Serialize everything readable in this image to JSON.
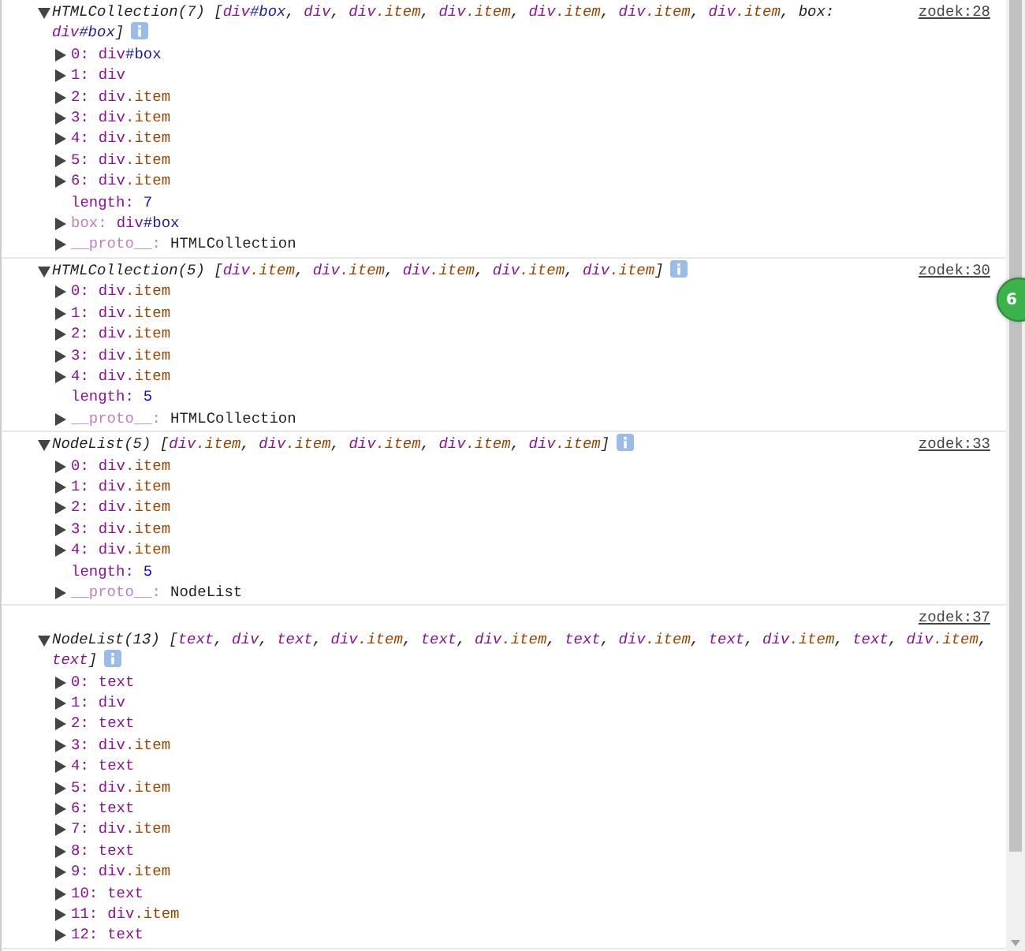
{
  "entries": [
    {
      "source": "zodek:28",
      "source_above": false,
      "expanded": true,
      "type": "HTMLCollection(7)",
      "open": "[",
      "close": "]",
      "preview": [
        {
          "tag": "div",
          "id": "#box",
          "sep": ", "
        },
        {
          "tag": "div",
          "sep": ", "
        },
        {
          "tag": "div",
          "cls": ".item",
          "sep": ", "
        },
        {
          "tag": "div",
          "cls": ".item",
          "sep": ", "
        },
        {
          "tag": "div",
          "cls": ".item",
          "sep": ", "
        },
        {
          "tag": "div",
          "cls": ".item",
          "sep": ", "
        },
        {
          "tag": "div",
          "cls": ".item",
          "sep": ", "
        },
        {
          "key": "box: ",
          "tag": "div",
          "id": "#box"
        }
      ],
      "items": [
        {
          "key": "0:",
          "dimmed": false,
          "expanded": false,
          "value": {
            "tag": "div",
            "id": "#box"
          }
        },
        {
          "key": "1:",
          "dimmed": false,
          "expanded": false,
          "value": {
            "tag": "div"
          }
        },
        {
          "key": "2:",
          "dimmed": false,
          "expanded": false,
          "value": {
            "tag": "div",
            "cls": ".item"
          }
        },
        {
          "key": "3:",
          "dimmed": false,
          "expanded": false,
          "value": {
            "tag": "div",
            "cls": ".item"
          }
        },
        {
          "key": "4:",
          "dimmed": false,
          "expanded": false,
          "value": {
            "tag": "div",
            "cls": ".item"
          }
        },
        {
          "key": "5:",
          "dimmed": false,
          "expanded": false,
          "value": {
            "tag": "div",
            "cls": ".item"
          }
        },
        {
          "key": "6:",
          "dimmed": false,
          "expanded": false,
          "value": {
            "tag": "div",
            "cls": ".item"
          }
        },
        {
          "key": "length:",
          "dimmed": false,
          "value": {
            "num": "7"
          }
        },
        {
          "key": "box:",
          "dimmed": true,
          "expanded": false,
          "value": {
            "tag": "div",
            "id": "#box"
          }
        },
        {
          "key": "__proto__:",
          "dimmed": true,
          "expanded": false,
          "value": {
            "text": "HTMLCollection"
          }
        }
      ]
    },
    {
      "source": "zodek:30",
      "source_above": false,
      "expanded": true,
      "type": "HTMLCollection(5)",
      "open": "[",
      "close": "]",
      "preview": [
        {
          "tag": "div",
          "cls": ".item",
          "sep": ", "
        },
        {
          "tag": "div",
          "cls": ".item",
          "sep": ", "
        },
        {
          "tag": "div",
          "cls": ".item",
          "sep": ", "
        },
        {
          "tag": "div",
          "cls": ".item",
          "sep": ", "
        },
        {
          "tag": "div",
          "cls": ".item"
        }
      ],
      "items": [
        {
          "key": "0:",
          "dimmed": false,
          "expanded": false,
          "value": {
            "tag": "div",
            "cls": ".item"
          }
        },
        {
          "key": "1:",
          "dimmed": false,
          "expanded": false,
          "value": {
            "tag": "div",
            "cls": ".item"
          }
        },
        {
          "key": "2:",
          "dimmed": false,
          "expanded": false,
          "value": {
            "tag": "div",
            "cls": ".item"
          }
        },
        {
          "key": "3:",
          "dimmed": false,
          "expanded": false,
          "value": {
            "tag": "div",
            "cls": ".item"
          }
        },
        {
          "key": "4:",
          "dimmed": false,
          "expanded": false,
          "value": {
            "tag": "div",
            "cls": ".item"
          }
        },
        {
          "key": "length:",
          "dimmed": false,
          "value": {
            "num": "5"
          }
        },
        {
          "key": "__proto__:",
          "dimmed": true,
          "expanded": false,
          "value": {
            "text": "HTMLCollection"
          }
        }
      ]
    },
    {
      "source": "zodek:33",
      "source_above": false,
      "expanded": true,
      "type": "NodeList(5)",
      "open": "[",
      "close": "]",
      "preview": [
        {
          "tag": "div",
          "cls": ".item",
          "sep": ", "
        },
        {
          "tag": "div",
          "cls": ".item",
          "sep": ", "
        },
        {
          "tag": "div",
          "cls": ".item",
          "sep": ", "
        },
        {
          "tag": "div",
          "cls": ".item",
          "sep": ", "
        },
        {
          "tag": "div",
          "cls": ".item"
        }
      ],
      "items": [
        {
          "key": "0:",
          "dimmed": false,
          "expanded": false,
          "value": {
            "tag": "div",
            "cls": ".item"
          }
        },
        {
          "key": "1:",
          "dimmed": false,
          "expanded": false,
          "value": {
            "tag": "div",
            "cls": ".item"
          }
        },
        {
          "key": "2:",
          "dimmed": false,
          "expanded": false,
          "value": {
            "tag": "div",
            "cls": ".item"
          }
        },
        {
          "key": "3:",
          "dimmed": false,
          "expanded": false,
          "value": {
            "tag": "div",
            "cls": ".item"
          }
        },
        {
          "key": "4:",
          "dimmed": false,
          "expanded": false,
          "value": {
            "tag": "div",
            "cls": ".item"
          }
        },
        {
          "key": "length:",
          "dimmed": false,
          "value": {
            "num": "5"
          }
        },
        {
          "key": "__proto__:",
          "dimmed": true,
          "expanded": false,
          "value": {
            "text": "NodeList"
          }
        }
      ]
    },
    {
      "source": "zodek:37",
      "source_above": true,
      "expanded": true,
      "type": "NodeList(13)",
      "open": "[",
      "close": "]",
      "preview": [
        {
          "tag": "text",
          "sep": ", "
        },
        {
          "tag": "div",
          "sep": ", "
        },
        {
          "tag": "text",
          "sep": ", "
        },
        {
          "tag": "div",
          "cls": ".item",
          "sep": ", "
        },
        {
          "tag": "text",
          "sep": ", "
        },
        {
          "tag": "div",
          "cls": ".item",
          "sep": ", "
        },
        {
          "tag": "text",
          "sep": ", "
        },
        {
          "tag": "div",
          "cls": ".item",
          "sep": ", "
        },
        {
          "tag": "text",
          "sep": ", "
        },
        {
          "tag": "div",
          "cls": ".item",
          "sep": ", "
        },
        {
          "tag": "text",
          "sep": ", "
        },
        {
          "tag": "div",
          "cls": ".item",
          "sep": ", "
        },
        {
          "tag": "text"
        }
      ],
      "items": [
        {
          "key": "0:",
          "dimmed": false,
          "expanded": false,
          "value": {
            "tag": "text"
          }
        },
        {
          "key": "1:",
          "dimmed": false,
          "expanded": false,
          "value": {
            "tag": "div"
          }
        },
        {
          "key": "2:",
          "dimmed": false,
          "expanded": false,
          "value": {
            "tag": "text"
          }
        },
        {
          "key": "3:",
          "dimmed": false,
          "expanded": false,
          "value": {
            "tag": "div",
            "cls": ".item"
          }
        },
        {
          "key": "4:",
          "dimmed": false,
          "expanded": false,
          "value": {
            "tag": "text"
          }
        },
        {
          "key": "5:",
          "dimmed": false,
          "expanded": false,
          "value": {
            "tag": "div",
            "cls": ".item"
          }
        },
        {
          "key": "6:",
          "dimmed": false,
          "expanded": false,
          "value": {
            "tag": "text"
          }
        },
        {
          "key": "7:",
          "dimmed": false,
          "expanded": false,
          "value": {
            "tag": "div",
            "cls": ".item"
          }
        },
        {
          "key": "8:",
          "dimmed": false,
          "expanded": false,
          "value": {
            "tag": "text"
          }
        },
        {
          "key": "9:",
          "dimmed": false,
          "expanded": false,
          "value": {
            "tag": "div",
            "cls": ".item"
          }
        },
        {
          "key": "10:",
          "dimmed": false,
          "expanded": false,
          "value": {
            "tag": "text"
          }
        },
        {
          "key": "11:",
          "dimmed": false,
          "expanded": false,
          "value": {
            "tag": "div",
            "cls": ".item"
          }
        },
        {
          "key": "12:",
          "dimmed": false,
          "expanded": false,
          "value": {
            "tag": "text"
          }
        }
      ]
    }
  ],
  "floating_badge": {
    "text": "6"
  }
}
